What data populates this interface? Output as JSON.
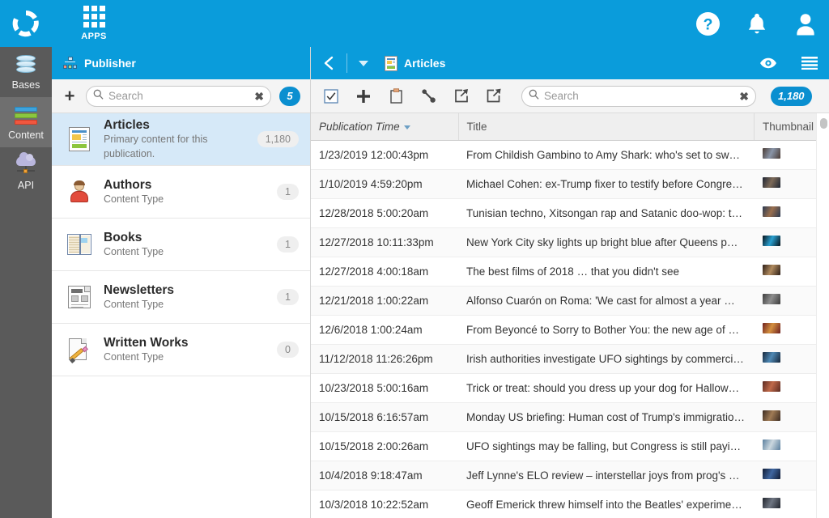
{
  "topbar": {
    "logo_icon": "recycle-logo-icon",
    "apps_label": "APPS",
    "apps_icon": "apps-grid-icon",
    "help_icon": "help-circle-icon",
    "notifications_icon": "bell-icon",
    "account_icon": "user-avatar-icon",
    "background_color": "#0a9cdb"
  },
  "rail": {
    "items": [
      {
        "label": "Bases",
        "icon": "database-icon",
        "active": false
      },
      {
        "label": "Content",
        "icon": "stacked-bars-icon",
        "active": true
      },
      {
        "label": "API",
        "icon": "cloud-api-icon",
        "active": false
      }
    ]
  },
  "publisher_panel": {
    "header": {
      "title": "Publisher",
      "icon": "sitemap-icon"
    },
    "toolbar": {
      "add_label": "+",
      "search": {
        "placeholder": "Search",
        "value": "",
        "icon": "search-icon",
        "clear_icon": "clear-x-icon"
      },
      "count_badge": "5"
    },
    "content_types": [
      {
        "name": "Articles",
        "subtitle": "Primary content for this publication.",
        "count": "1,180",
        "icon": "article-doc-icon",
        "selected": true
      },
      {
        "name": "Authors",
        "subtitle": "Content Type",
        "count": "1",
        "icon": "author-person-icon",
        "selected": false
      },
      {
        "name": "Books",
        "subtitle": "Content Type",
        "count": "1",
        "icon": "open-book-icon",
        "selected": false
      },
      {
        "name": "Newsletters",
        "subtitle": "Content Type",
        "count": "1",
        "icon": "newspaper-icon",
        "selected": false
      },
      {
        "name": "Written Works",
        "subtitle": "Content Type",
        "count": "0",
        "icon": "pencil-page-icon",
        "selected": false
      }
    ]
  },
  "right_pane": {
    "header": {
      "back_icon": "chevron-left-icon",
      "dropdown_icon": "caret-down-icon",
      "title": "Articles",
      "title_icon": "article-doc-icon",
      "preview_icon": "eye-icon",
      "menu_icon": "hamburger-menu-icon"
    },
    "toolbar": {
      "icons": [
        {
          "name": "select-all-checkbox-icon"
        },
        {
          "name": "add-record-icon"
        },
        {
          "name": "clipboard-paste-icon"
        },
        {
          "name": "link-chain-icon"
        },
        {
          "name": "import-arrow-icon"
        },
        {
          "name": "export-arrow-icon"
        }
      ],
      "search": {
        "placeholder": "Search",
        "value": "",
        "icon": "search-icon",
        "clear_icon": "clear-x-icon"
      },
      "count_badge": "1,180"
    },
    "table": {
      "columns": [
        {
          "label": "Publication Time",
          "sorted": true,
          "sort_direction": "desc"
        },
        {
          "label": "Title",
          "sorted": false
        },
        {
          "label": "Thumbnail",
          "sorted": false
        }
      ],
      "rows": [
        {
          "time": "1/23/2019 12:00:43pm",
          "title": "From Childish Gambino to Amy Shark: who's set to sw…",
          "thumb_colors": [
            "#4a3b33",
            "#8a95a8"
          ]
        },
        {
          "time": "1/10/2019 4:59:20pm",
          "title": "Michael Cohen: ex-Trump fixer to testify before Congre…",
          "thumb_colors": [
            "#1d2533",
            "#7d6a58"
          ]
        },
        {
          "time": "12/28/2018 5:00:20am",
          "title": "Tunisian techno, Xitsongan rap and Satanic doo-wop: t…",
          "thumb_colors": [
            "#2a3a52",
            "#9a6f4e"
          ]
        },
        {
          "time": "12/27/2018 10:11:33pm",
          "title": "New York City sky lights up bright blue after Queens p…",
          "thumb_colors": [
            "#061018",
            "#2aa0d0"
          ]
        },
        {
          "time": "12/27/2018 4:00:18am",
          "title": "The best films of 2018 … that you didn't see",
          "thumb_colors": [
            "#2b1d16",
            "#b08a5e"
          ]
        },
        {
          "time": "12/21/2018 1:00:22am",
          "title": "Alfonso Cuarón on Roma: 'We cast for almost a year …",
          "thumb_colors": [
            "#3c3c3c",
            "#8e8e8e"
          ]
        },
        {
          "time": "12/6/2018 1:00:24am",
          "title": "From Beyoncé to Sorry to Bother You: the new age of …",
          "thumb_colors": [
            "#6d1f1f",
            "#d4903f"
          ]
        },
        {
          "time": "11/12/2018 11:26:26pm",
          "title": "Irish authorities investigate UFO sightings by commerci…",
          "thumb_colors": [
            "#16263a",
            "#4f89b5"
          ]
        },
        {
          "time": "10/23/2018 5:00:16am",
          "title": "Trick or treat: should you dress up your dog for Hallow…",
          "thumb_colors": [
            "#5a2a22",
            "#c06a4a"
          ]
        },
        {
          "time": "10/15/2018 6:16:57am",
          "title": "Monday US briefing: Human cost of Trump's immigratio…",
          "thumb_colors": [
            "#3a2b22",
            "#a07b55"
          ]
        },
        {
          "time": "10/15/2018 2:00:26am",
          "title": "UFO sightings may be falling, but Congress is still payi…",
          "thumb_colors": [
            "#5a7f9e",
            "#cbd7df"
          ]
        },
        {
          "time": "10/4/2018 9:18:47am",
          "title": "Jeff Lynne's ELO review – interstellar joys from prog's …",
          "thumb_colors": [
            "#101b33",
            "#3f66a0"
          ]
        },
        {
          "time": "10/3/2018 10:22:52am",
          "title": "Geoff Emerick threw himself into the Beatles' experime…",
          "thumb_colors": [
            "#20242c",
            "#6f7682"
          ]
        }
      ]
    }
  }
}
